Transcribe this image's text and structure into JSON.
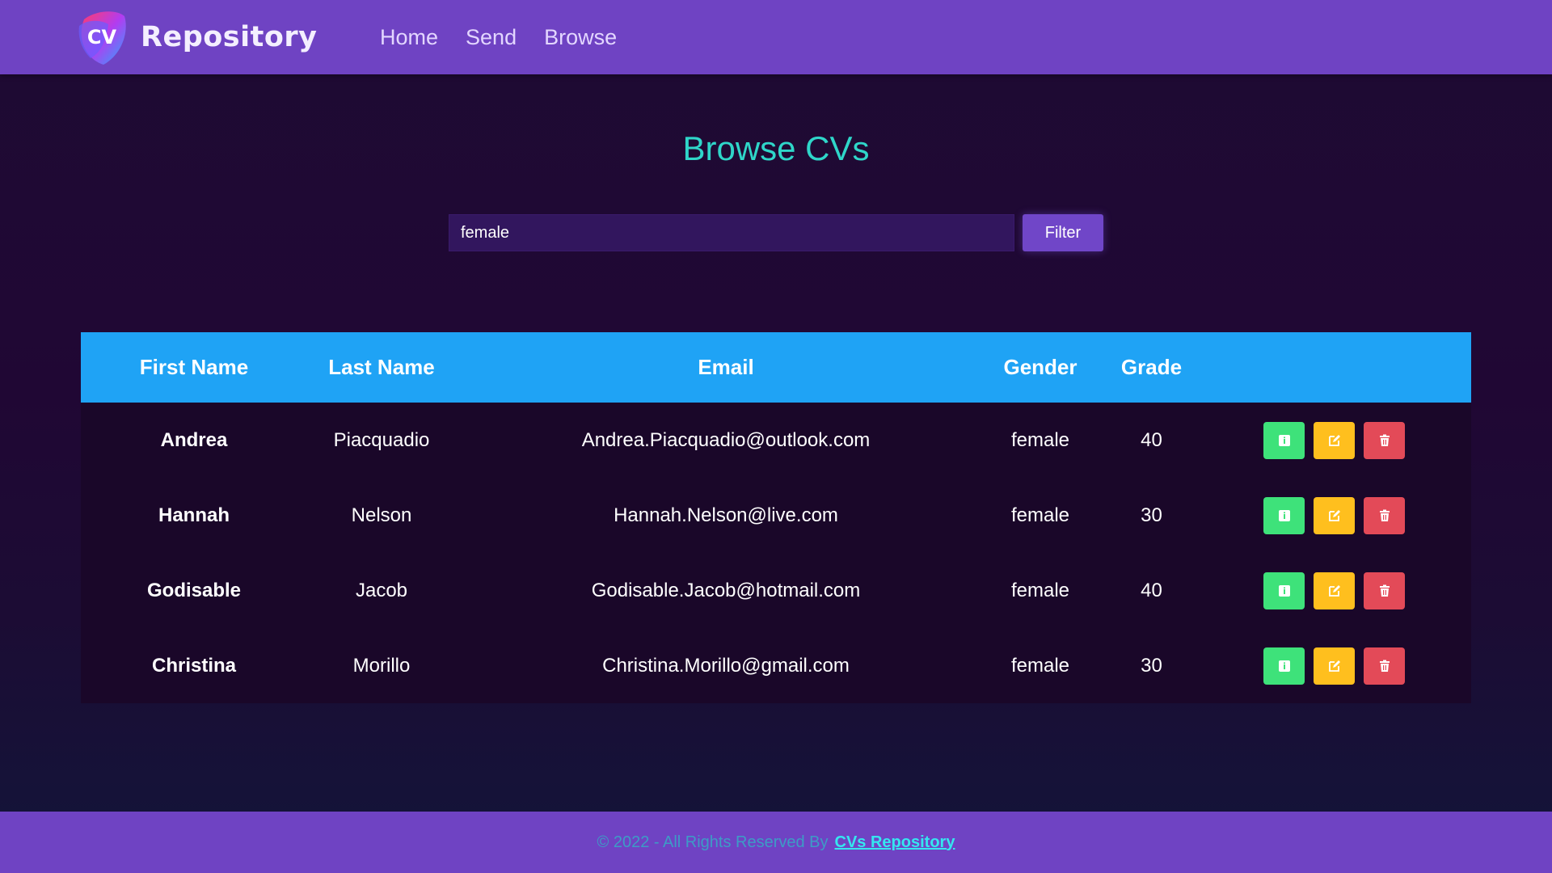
{
  "nav": {
    "brand": "Repository",
    "logo_text": "CV",
    "links": [
      "Home",
      "Send",
      "Browse"
    ]
  },
  "main": {
    "title": "Browse CVs",
    "search": {
      "value": "female"
    },
    "filter_label": "Filter"
  },
  "table": {
    "headers": [
      "First Name",
      "Last Name",
      "Email",
      "Gender",
      "Grade"
    ],
    "rows": [
      {
        "first": "Andrea",
        "last": "Piacquadio",
        "email": "Andrea.Piacquadio@outlook.com",
        "gender": "female",
        "grade": "40"
      },
      {
        "first": "Hannah",
        "last": "Nelson",
        "email": "Hannah.Nelson@live.com",
        "gender": "female",
        "grade": "30"
      },
      {
        "first": "Godisable",
        "last": "Jacob",
        "email": "Godisable.Jacob@hotmail.com",
        "gender": "female",
        "grade": "40"
      },
      {
        "first": "Christina",
        "last": "Morillo",
        "email": "Christina.Morillo@gmail.com",
        "gender": "female",
        "grade": "30"
      }
    ],
    "row_actions": [
      {
        "icon": "info-icon",
        "color": "#3ee27a"
      },
      {
        "icon": "edit-icon",
        "color": "#ffbf1e"
      },
      {
        "icon": "trash-icon",
        "color": "#e34a58"
      }
    ]
  },
  "footer": {
    "text": "© 2022 - All Rights Reserved By",
    "link": "CVs Repository"
  },
  "colors": {
    "navbar": "#6f43c3",
    "title": "#2fd6c9",
    "table_header": "#1fa3f5",
    "background": "#1e0b33"
  }
}
